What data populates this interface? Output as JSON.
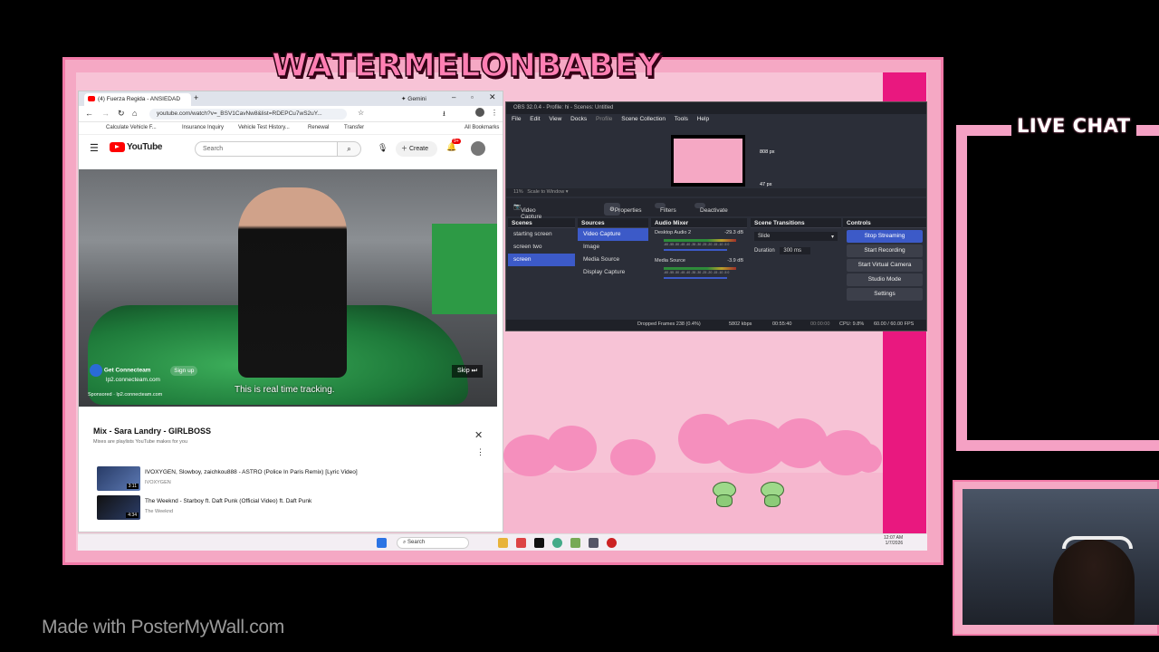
{
  "banner": "WATERMELONBABEY",
  "live_chat": "LIVE CHAT",
  "watermark": "Made with PosterMyWall.com",
  "browser": {
    "tab_title": "(4) Fuerza Regida - ANSIEDAD",
    "gemini": "Gemini",
    "url": "youtube.com/watch?v=_BSV1CavNw8&list=RDEPCu7wS2uY...",
    "bookmarks": [
      "Calculate Vehicle F...",
      "Insurance Inquiry",
      "Vehicle Test History...",
      "Renewal",
      "Transfer"
    ],
    "all_bookmarks": "All Bookmarks",
    "search_placeholder": "Search",
    "create": "Create",
    "notif_count": "9+",
    "youtube": "YouTube",
    "ad_name": "Get Connecteam",
    "ad_sign_up": "Sign up",
    "ad_url": "lp2.connecteam.com",
    "sponsored": "Sponsored",
    "ad_url2": "lp2.connecteam.com",
    "caption": "This is real time tracking.",
    "skip": "Skip",
    "mix_title": "Mix - Sara Landry - GIRLBOSS",
    "mix_sub": "Mixes are playlists YouTube makes for you",
    "rows": [
      {
        "title": "IVOXYGEN, Slowboy, zaichkou888 - ASTRO (Police In Paris Remix) [Lyric Video]",
        "artist": "IVOXYGEN",
        "duration": "3:11"
      },
      {
        "title": "The Weeknd - Starboy ft. Daft Punk (Official Video) ft. Daft Punk",
        "artist": "The Weeknd",
        "duration": "4:34"
      }
    ]
  },
  "obs": {
    "title": "OBS 32.0.4 - Profile: hi - Scenes: Untitled",
    "menu": [
      "File",
      "Edit",
      "View",
      "Docks",
      "Profile",
      "Scene Collection",
      "Tools",
      "Help"
    ],
    "preview_px1": "808 px",
    "preview_px2": "47 px",
    "zoom": "11%",
    "scale": "Scale to Window",
    "source_label": "Video Capture Device",
    "properties": "Properties",
    "filters": "Filters",
    "deactivate": "Deactivate",
    "docks": {
      "scenes": {
        "title": "Scenes",
        "items": [
          "starting screen",
          "screen two",
          "screen"
        ]
      },
      "sources": {
        "title": "Sources",
        "items": [
          "Video Capture",
          "Image",
          "Media Source",
          "Display Capture"
        ]
      },
      "mixer": {
        "title": "Audio Mixer",
        "ch1": "Desktop Audio 2",
        "ch1_db": "-29.3 dB",
        "ch2": "Media Source",
        "ch2_db": "-3.9 dB",
        "scale": "-60 -55 -50 -45 -40 -35 -30 -25 -20 -15 -10 -5 0"
      },
      "transitions": {
        "title": "Scene Transitions",
        "type": "Slide",
        "duration_label": "Duration",
        "duration": "300 ms"
      },
      "controls": {
        "title": "Controls",
        "items": [
          "Stop Streaming",
          "Start Recording",
          "Start Virtual Camera",
          "Studio Mode",
          "Settings"
        ]
      }
    },
    "status": {
      "dropped": "Dropped Frames 238 (0.4%)",
      "kbps": "5802 kbps",
      "live": "00:55:40",
      "rec": "00:00:00",
      "cpu": "CPU: 9.8%",
      "fps": "60.00 / 60.00 FPS"
    }
  },
  "taskbar": {
    "search": "Search",
    "time": "12:07 AM",
    "date": "1/7/2026"
  },
  "colors": {
    "frame": "#f5a8c4",
    "magenta": "#e9187f",
    "banner": "#ff7fb3",
    "obs_bg": "#2b2e38",
    "obs_blue": "#3c5ac8"
  }
}
